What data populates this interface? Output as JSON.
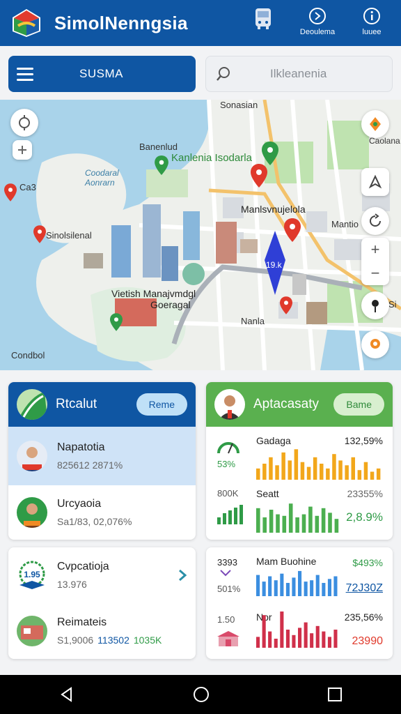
{
  "app": {
    "title": "SimolNenngsia"
  },
  "header": {
    "actions": [
      {
        "label": "",
        "icon": "bus-icon"
      },
      {
        "label": "Deoulema",
        "icon": "profile-icon"
      },
      {
        "label": "luuee",
        "icon": "info-icon"
      }
    ]
  },
  "toolbar": {
    "menu_label": "SUSMA",
    "search_placeholder": "Ilkleanenia"
  },
  "map": {
    "labels": {
      "top": "Sonasian",
      "place_a": "Banenlud",
      "green_place": "Kanlenia Isodarla",
      "water": "Coodaral\nAonrarn",
      "pin_a": "Ca3",
      "left_shore": "Sinolsilenal",
      "district": "Manlsvnujelola",
      "right": "Mantio",
      "center_a": "Vietish Manajvmdgl",
      "center_b": "Goeragal",
      "small_a": "Nanla",
      "bottom_left": "Condbol",
      "edge_right": "Si",
      "tl_ctrl_label": "Caolana",
      "marker_text": "19.k"
    },
    "colors": {
      "road": "#f3c26b",
      "water": "#a9d3ea",
      "park": "#bfe3b0"
    }
  },
  "cards": {
    "left_top": {
      "title": "Rtcalut",
      "pill": "Reme",
      "rows": [
        {
          "name": "Napatotia",
          "sub": "825612 2871%"
        },
        {
          "name": "Urcyaoia",
          "sub": "Sa1/83, 02,076%"
        }
      ]
    },
    "right_top": {
      "title": "Aptacasaty",
      "pill": "Bame",
      "side_a": "53%",
      "side_b": "800K",
      "rows": [
        {
          "label": "Gadaga",
          "value": "132,59%",
          "bars": [
            0.35,
            0.5,
            0.7,
            0.45,
            0.85,
            0.6,
            0.95,
            0.55,
            0.4,
            0.7,
            0.5,
            0.35,
            0.8,
            0.6,
            0.45,
            0.7,
            0.3,
            0.55,
            0.25,
            0.35
          ]
        },
        {
          "label": "Seatt",
          "value": "23355%",
          "value2": "2,8.9%",
          "bars": [
            0.8,
            0.5,
            0.75,
            0.6,
            0.55,
            0.95,
            0.5,
            0.6,
            0.85,
            0.55,
            0.8,
            0.65,
            0.45
          ]
        }
      ]
    },
    "left_bottom": {
      "rows": [
        {
          "name": "Cvpcatioja",
          "sub": "13.976"
        },
        {
          "name": "Reimateis",
          "sub_a": "S1,9006",
          "sub_b": "113502",
          "sub_c": "1035K"
        }
      ]
    },
    "right_bottom": {
      "side_a": "3393",
      "side_b": "501%",
      "side_c": "1.50",
      "rows": [
        {
          "label": "Mam Buohine",
          "value": "$493%",
          "value2": "72J30Z",
          "bars": [
            0.8,
            0.55,
            0.75,
            0.6,
            0.85,
            0.5,
            0.7,
            0.95,
            0.55,
            0.6,
            0.8,
            0.5,
            0.65,
            0.75
          ]
        },
        {
          "label": "Nor",
          "value": "235,56%",
          "value2": "23990",
          "bars": [
            0.3,
            0.9,
            0.45,
            0.25,
            1.0,
            0.5,
            0.35,
            0.55,
            0.7,
            0.4,
            0.6,
            0.45,
            0.3,
            0.5
          ]
        }
      ]
    }
  },
  "navbar": {
    "items": [
      "back-icon",
      "home-icon",
      "recents-icon"
    ]
  }
}
